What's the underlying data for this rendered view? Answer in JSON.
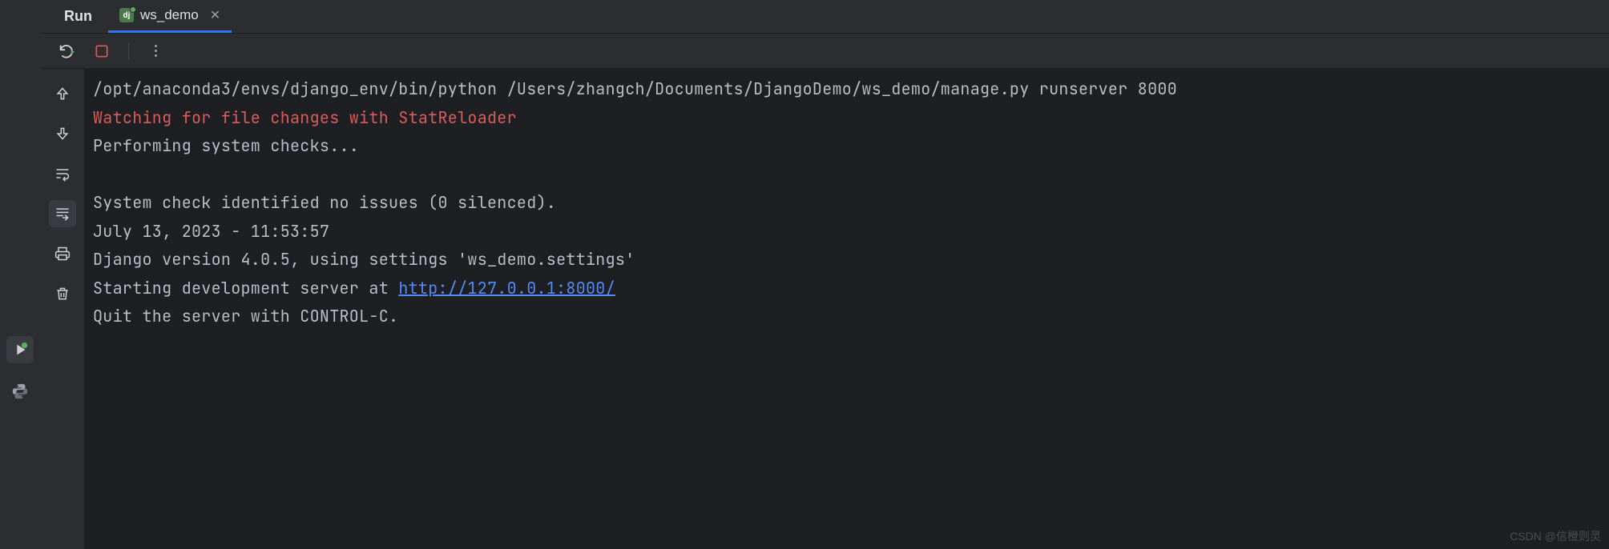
{
  "header": {
    "panel_title": "Run",
    "tab": {
      "icon_label": "dj",
      "name": "ws_demo"
    }
  },
  "toolbar": {
    "rerun": "Rerun",
    "stop": "Stop",
    "more": "More"
  },
  "side": {
    "up": "Up the stack trace",
    "down": "Down the stack trace",
    "soft_wrap": "Soft-Wrap",
    "scroll_end": "Scroll to End",
    "print": "Print",
    "delete": "Clear All"
  },
  "left_gutter": {
    "run": "Run",
    "python": "Python Console"
  },
  "console": {
    "line1": "/opt/anaconda3/envs/django_env/bin/python /Users/zhangch/Documents/DjangoDemo/ws_demo/manage.py runserver 8000",
    "line2": "Watching for file changes with StatReloader",
    "line3": "Performing system checks...",
    "line4": "",
    "line5": "System check identified no issues (0 silenced).",
    "line6": "July 13, 2023 - 11:53:57",
    "line7": "Django version 4.0.5, using settings 'ws_demo.settings'",
    "line8_prefix": "Starting development server at ",
    "line8_link": "http://127.0.0.1:8000/",
    "line9": "Quit the server with CONTROL-C."
  },
  "watermark": "CSDN @信橙则灵"
}
